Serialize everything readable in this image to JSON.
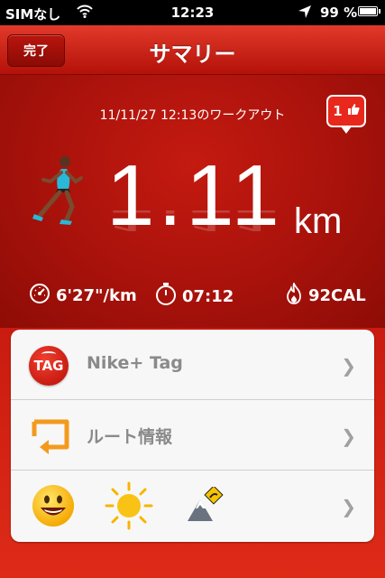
{
  "status_bar": {
    "carrier": "SIMなし",
    "time": "12:23",
    "battery_percent": "99 %",
    "battery_level": 0.99
  },
  "nav": {
    "done_label": "完了",
    "title": "サマリー"
  },
  "summary": {
    "workout_label": "11/11/27 12:13のワークアウト",
    "like_count": "1",
    "distance": "1.11",
    "unit": "km",
    "pace": "6'27\"/km",
    "duration": "07:12",
    "calories": "92CAL"
  },
  "list": {
    "items": [
      {
        "label": "Nike+ Tag",
        "icon_text": "TAG"
      },
      {
        "label": "ルート情報"
      },
      {
        "label": ""
      }
    ]
  },
  "icons": {
    "wifi": "wifi-icon",
    "location": "location-arrow-icon",
    "like": "thumbs-up-icon",
    "runner": "runner-icon",
    "pace": "speedometer-icon",
    "timer": "stopwatch-icon",
    "calories": "flame-icon",
    "tag": "nike-tag-icon",
    "route": "route-icon",
    "mood": "smiley-icon",
    "weather": "sun-icon",
    "terrain": "terrain-icon",
    "chevron": "chevron-right-icon"
  },
  "colors": {
    "accent": "#c61a12",
    "card": "#f7f7f7"
  }
}
